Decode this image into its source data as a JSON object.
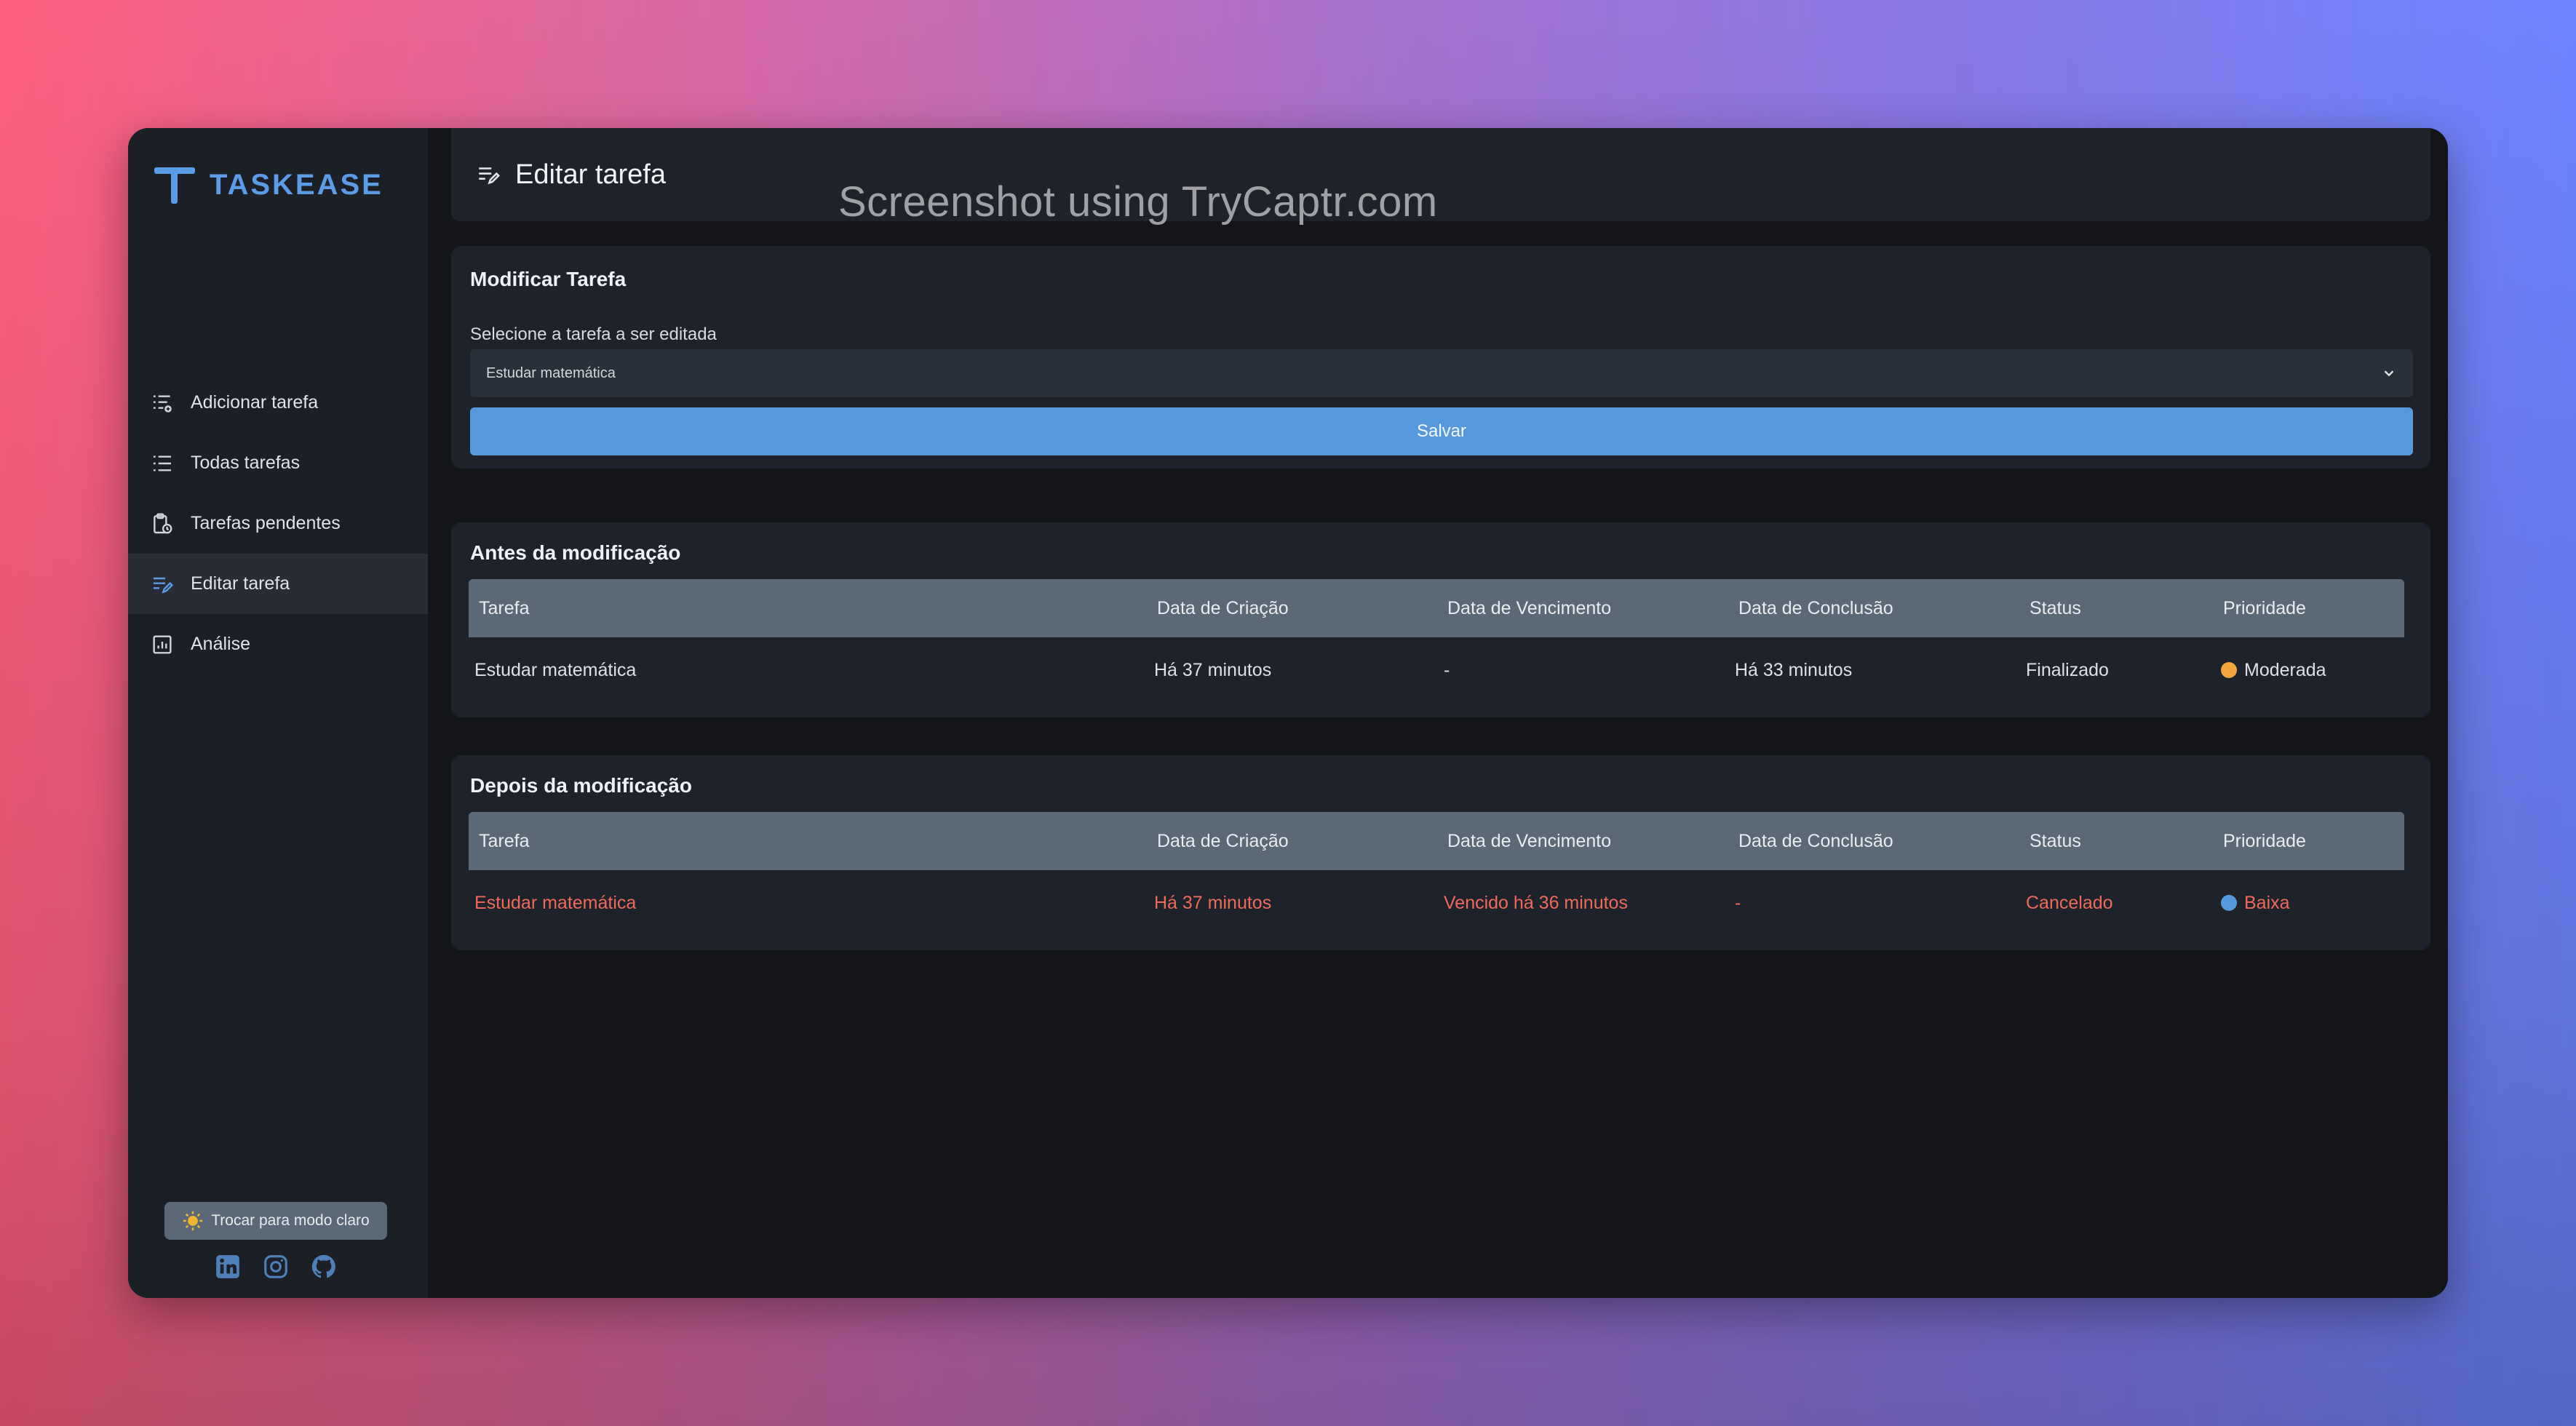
{
  "brand": {
    "name": "TASKEASE",
    "accent": "#5b9ce6"
  },
  "sidebar": {
    "items": [
      {
        "label": "Adicionar tarefa",
        "icon": "list-add-icon"
      },
      {
        "label": "Todas tarefas",
        "icon": "list-icon"
      },
      {
        "label": "Tarefas pendentes",
        "icon": "clipboard-clock-icon"
      },
      {
        "label": "Editar tarefa",
        "icon": "edit-list-icon",
        "active": true
      },
      {
        "label": "Análise",
        "icon": "chart-icon"
      }
    ],
    "theme_toggle": "Trocar para modo claro",
    "socials": [
      "linkedin-icon",
      "instagram-icon",
      "github-icon"
    ]
  },
  "header": {
    "title": "Editar tarefa"
  },
  "watermark": "Screenshot using TryCaptr.com",
  "modify": {
    "title": "Modificar Tarefa",
    "select_label": "Selecione a tarefa a ser editada",
    "selected_task": "Estudar matemática",
    "save_label": "Salvar",
    "save_color": "#5599dc"
  },
  "columns": [
    "Tarefa",
    "Data de Criação",
    "Data de Vencimento",
    "Data de Conclusão",
    "Status",
    "Prioridade"
  ],
  "before": {
    "title": "Antes da modificação",
    "row": {
      "tarefa": "Estudar matemática",
      "criacao": "Há 37 minutos",
      "vencimento": "-",
      "conclusao": "Há 33 minutos",
      "status": "Finalizado",
      "prioridade": "Moderada",
      "prioridade_color": "#f2a63b"
    }
  },
  "after": {
    "title": "Depois da modificação",
    "row": {
      "tarefa": "Estudar matemática",
      "criacao": "Há 37 minutos",
      "vencimento": "Vencido há 36 minutos",
      "conclusao": "-",
      "status": "Cancelado",
      "prioridade": "Baixa",
      "prioridade_color": "#5599dc",
      "text_color": "#ee6b5b"
    }
  }
}
